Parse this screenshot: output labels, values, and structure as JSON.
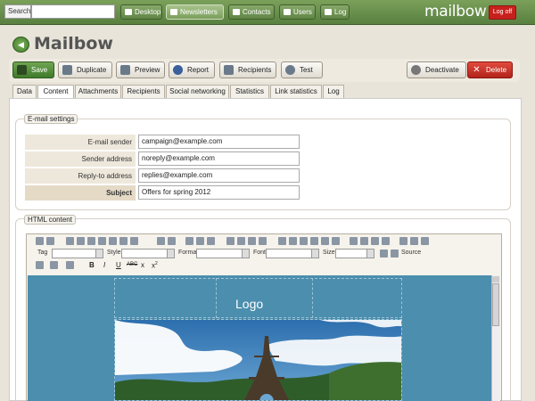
{
  "topbar": {
    "search_label": "Search",
    "search_value": "",
    "nav": [
      {
        "label": "Desktop",
        "active": false,
        "icon": "desktop-icon"
      },
      {
        "label": "Newsletters",
        "active": true,
        "icon": "newsletter-icon"
      },
      {
        "label": "Contacts",
        "active": false,
        "icon": "contacts-icon"
      },
      {
        "label": "Users",
        "active": false,
        "icon": "users-icon"
      },
      {
        "label": "Log",
        "active": false,
        "icon": "log-icon"
      }
    ],
    "brand": "mailbow",
    "logoff_label": "Log off"
  },
  "page": {
    "title": "Mailbow"
  },
  "toolbar": {
    "save": "Save",
    "duplicate": "Duplicate",
    "preview": "Preview",
    "report": "Report",
    "recipients": "Recipients",
    "test": "Test",
    "deactivate": "Deactivate",
    "delete": "Delete"
  },
  "tabs": [
    {
      "label": "Data",
      "active": false
    },
    {
      "label": "Content",
      "active": true
    },
    {
      "label": "Attachments",
      "active": false
    },
    {
      "label": "Recipients",
      "active": false
    },
    {
      "label": "Social networking",
      "active": false
    },
    {
      "label": "Statistics",
      "active": false
    },
    {
      "label": "Link statistics",
      "active": false
    },
    {
      "label": "Log",
      "active": false
    }
  ],
  "email_settings": {
    "legend": "E-mail settings",
    "fields": [
      {
        "label": "E-mail sender",
        "value": "campaign@example.com"
      },
      {
        "label": "Sender address",
        "value": "noreply@example.com"
      },
      {
        "label": "Reply-to address",
        "value": "replies@example.com"
      },
      {
        "label": "Subject",
        "value": "Offers for spring 2012"
      }
    ]
  },
  "html_content": {
    "legend": "HTML content",
    "editor": {
      "tag_label": "Tag",
      "style_label": "Style",
      "format_label": "Format",
      "font_label": "Font",
      "size_label": "Size",
      "source_label": "Source",
      "bold": "B",
      "italic": "I",
      "underline": "U",
      "strike": "ABC",
      "subscript": "x",
      "superscript": "x",
      "superscript_mark": "2"
    },
    "template": {
      "logo_text": "Logo"
    }
  },
  "colors": {
    "nav_green": "#5a8040",
    "accent_red": "#c8211d",
    "canvas_blue": "#4b8eae"
  }
}
